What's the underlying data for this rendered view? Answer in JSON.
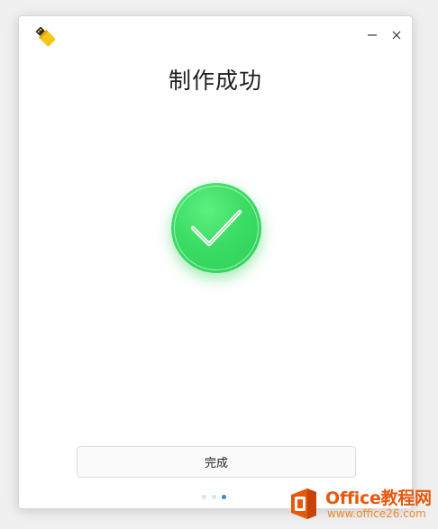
{
  "window": {
    "app_icon": "usb-drive-icon",
    "controls": {
      "minimize_icon": "minimize-icon",
      "close_icon": "close-icon"
    }
  },
  "main": {
    "title": "制作成功",
    "status_icon": "checkmark-circle-icon",
    "done_button_label": "完成"
  },
  "steps": {
    "total": 3,
    "current": 3
  },
  "watermark": {
    "name": "Office教程网",
    "url": "www.office26.com"
  },
  "colors": {
    "success_green": "#3bdc64",
    "active_dot": "#2b8ed8",
    "inactive_dot": "#d3e6f2",
    "watermark_orange": "#e8580c",
    "app_icon_yellow": "#f5c518"
  }
}
